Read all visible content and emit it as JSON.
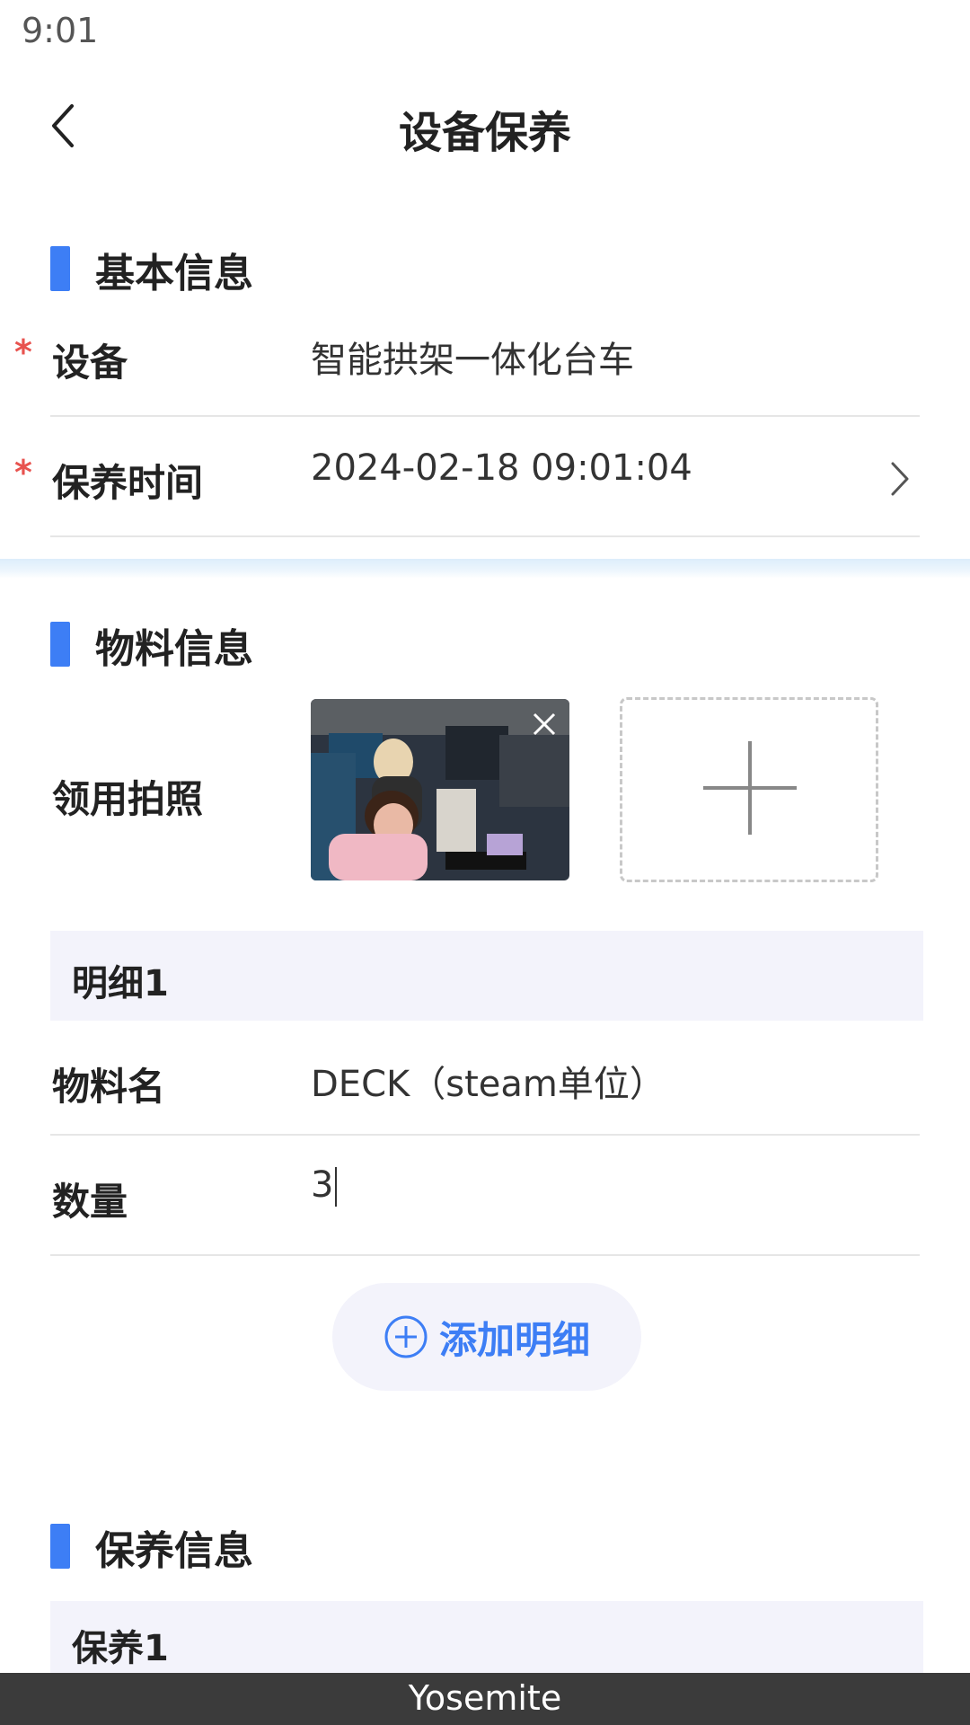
{
  "status_bar": {
    "time": "9:01"
  },
  "nav": {
    "title": "设备保养",
    "back_icon": "chevron-left-icon"
  },
  "basic_info": {
    "title": "基本信息",
    "device": {
      "required_mark": "*",
      "label": "设备",
      "value": "智能拱架一体化台车"
    },
    "maintenance_time": {
      "required_mark": "*",
      "label": "保养时间",
      "value": "2024-02-18 09:01:04",
      "icon": "chevron-right-icon"
    }
  },
  "material_info": {
    "title": "物料信息",
    "photo": {
      "label": "领用拍照",
      "close_icon": "close-icon",
      "add_icon": "plus-icon"
    },
    "details": [
      {
        "header": "明细1",
        "material_name": {
          "label": "物料名",
          "value": "DECK（steam单位）"
        },
        "quantity": {
          "label": "数量",
          "value": "3"
        }
      }
    ],
    "add_detail": {
      "label": "添加明细",
      "icon": "plus-circle-icon"
    }
  },
  "maintenance_info": {
    "title": "保养信息",
    "items": [
      {
        "header": "保养1"
      }
    ]
  },
  "bottom_bar": {
    "label": "Yosemite"
  },
  "colors": {
    "accent": "#3d7ef5",
    "required": "#e8534f",
    "detail_bg": "#f3f3fb"
  }
}
